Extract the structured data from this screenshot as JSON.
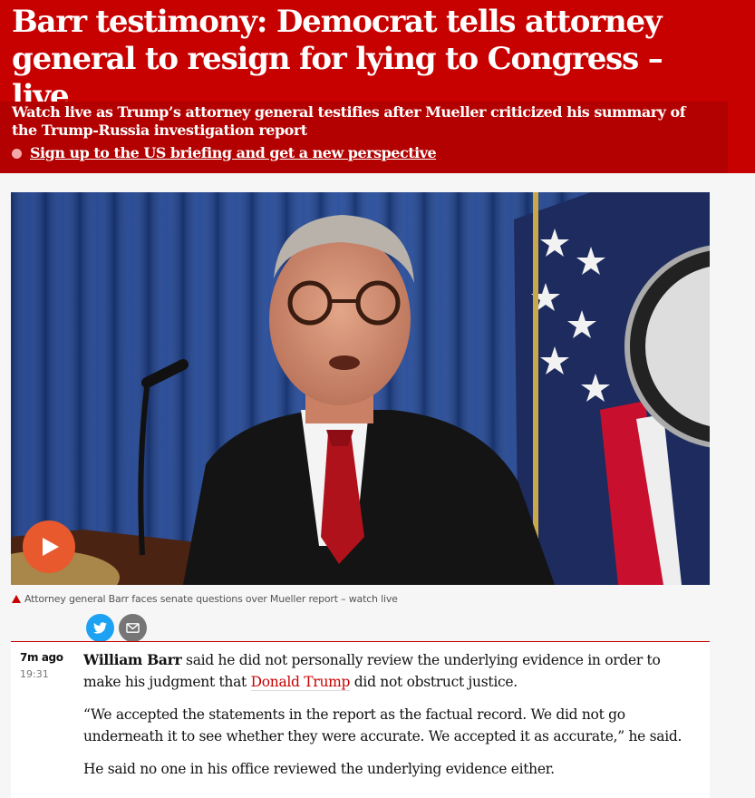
{
  "header": {
    "headline": "Barr testimony: Democrat tells attorney general to resign for lying to Congress – live",
    "standfirst": "Watch live as Trump’s attorney general testifies after Mueller criticized his summary of the Trump-Russia investigation report",
    "signup_link": "Sign up to the US briefing and get a new perspective",
    "colors": {
      "primary": "#c70000",
      "secondary": "#b30000"
    }
  },
  "media": {
    "play_icon": "play-icon",
    "caption": "Attorney general Barr faces senate questions over Mueller report – watch live"
  },
  "share": {
    "twitter_icon": "twitter-icon",
    "email_icon": "email-icon"
  },
  "live_block": {
    "relative_time": "7m ago",
    "time": "19:31",
    "p1_name": "William Barr",
    "p1_text_a": " said he did not personally review the underlying evidence in order to make his judgment that ",
    "p1_link": "Donald Trump",
    "p1_text_b": " did not obstruct justice.",
    "p2": "“We accepted the statements in the report as the factual record. We did not go underneath it to see whether they were accurate. We accepted it as accurate,” he said.",
    "p3": "He said no one in his office reviewed the underlying evidence either."
  }
}
